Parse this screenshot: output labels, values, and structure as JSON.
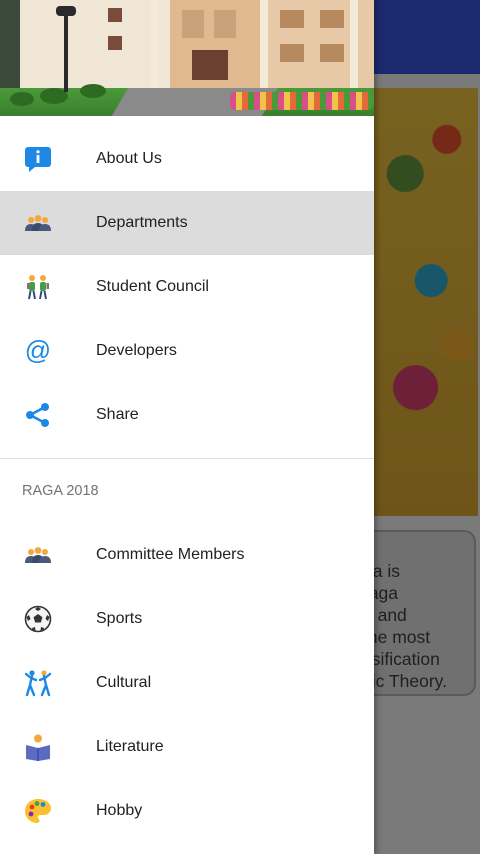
{
  "background": {
    "card_text": "ga is\nraga\ne and\nthe most\nssification\nsic Theory.",
    "toolbar_color": "#1b2a6e"
  },
  "drawer": {
    "header_image": "campus-building-photo",
    "primary_items": [
      {
        "label": "About Us",
        "icon": "info-icon",
        "selected": false
      },
      {
        "label": "Departments",
        "icon": "people-group-icon",
        "selected": true
      },
      {
        "label": "Student Council",
        "icon": "students-icon",
        "selected": false
      },
      {
        "label": "Developers",
        "icon": "at-sign-icon",
        "selected": false
      },
      {
        "label": "Share",
        "icon": "share-icon",
        "selected": false
      }
    ],
    "section_title": "RAGA 2018",
    "section_items": [
      {
        "label": "Committee Members",
        "icon": "people-group-icon"
      },
      {
        "label": "Sports",
        "icon": "soccer-ball-icon"
      },
      {
        "label": "Cultural",
        "icon": "dancers-icon"
      },
      {
        "label": "Literature",
        "icon": "reader-book-icon"
      },
      {
        "label": "Hobby",
        "icon": "palette-icon"
      }
    ]
  },
  "colors": {
    "accent_blue": "#1e88e5",
    "selected_bg": "#dcdcdc"
  }
}
